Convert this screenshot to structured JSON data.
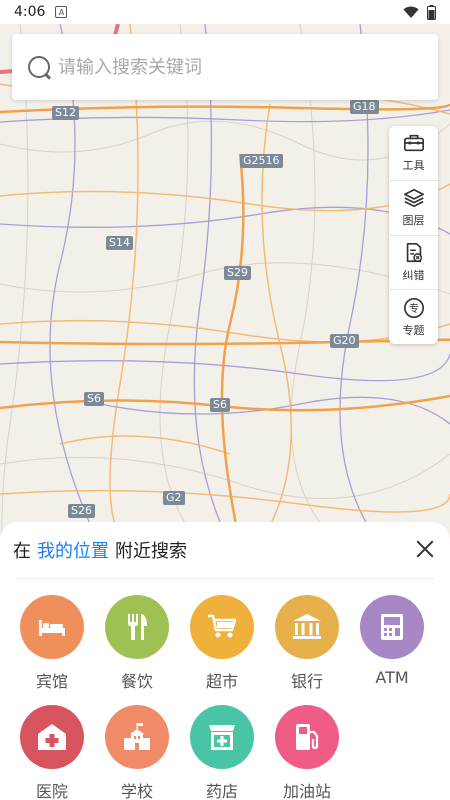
{
  "status": {
    "time": "4:06",
    "notif": "A"
  },
  "search": {
    "placeholder": "请输入搜索关键词"
  },
  "map": {
    "roads": [
      "S12",
      "G18",
      "G2516",
      "S14",
      "S29",
      "G20",
      "S6",
      "S6",
      "G2",
      "S26"
    ]
  },
  "tools": [
    {
      "label": "工具",
      "icon": "toolbox-icon"
    },
    {
      "label": "图层",
      "icon": "layers-icon"
    },
    {
      "label": "纠错",
      "icon": "error-report-icon"
    },
    {
      "label": "专题",
      "icon": "topic-icon"
    }
  ],
  "panel": {
    "prefix": "在",
    "location": "我的位置",
    "suffix": "附近搜索"
  },
  "categories": [
    {
      "label": "宾馆",
      "color": "#ef8f5b",
      "icon": "hotel-icon"
    },
    {
      "label": "餐饮",
      "color": "#9fc052",
      "icon": "restaurant-icon"
    },
    {
      "label": "超市",
      "color": "#f0b13c",
      "icon": "supermarket-icon"
    },
    {
      "label": "银行",
      "color": "#e8b04a",
      "icon": "bank-icon"
    },
    {
      "label": "ATM",
      "color": "#a787c6",
      "icon": "atm-icon"
    },
    {
      "label": "医院",
      "color": "#d8545e",
      "icon": "hospital-icon"
    },
    {
      "label": "学校",
      "color": "#f08a67",
      "icon": "school-icon"
    },
    {
      "label": "药店",
      "color": "#49c4a4",
      "icon": "pharmacy-icon"
    },
    {
      "label": "加油站",
      "color": "#ef5d86",
      "icon": "gas-station-icon"
    }
  ]
}
